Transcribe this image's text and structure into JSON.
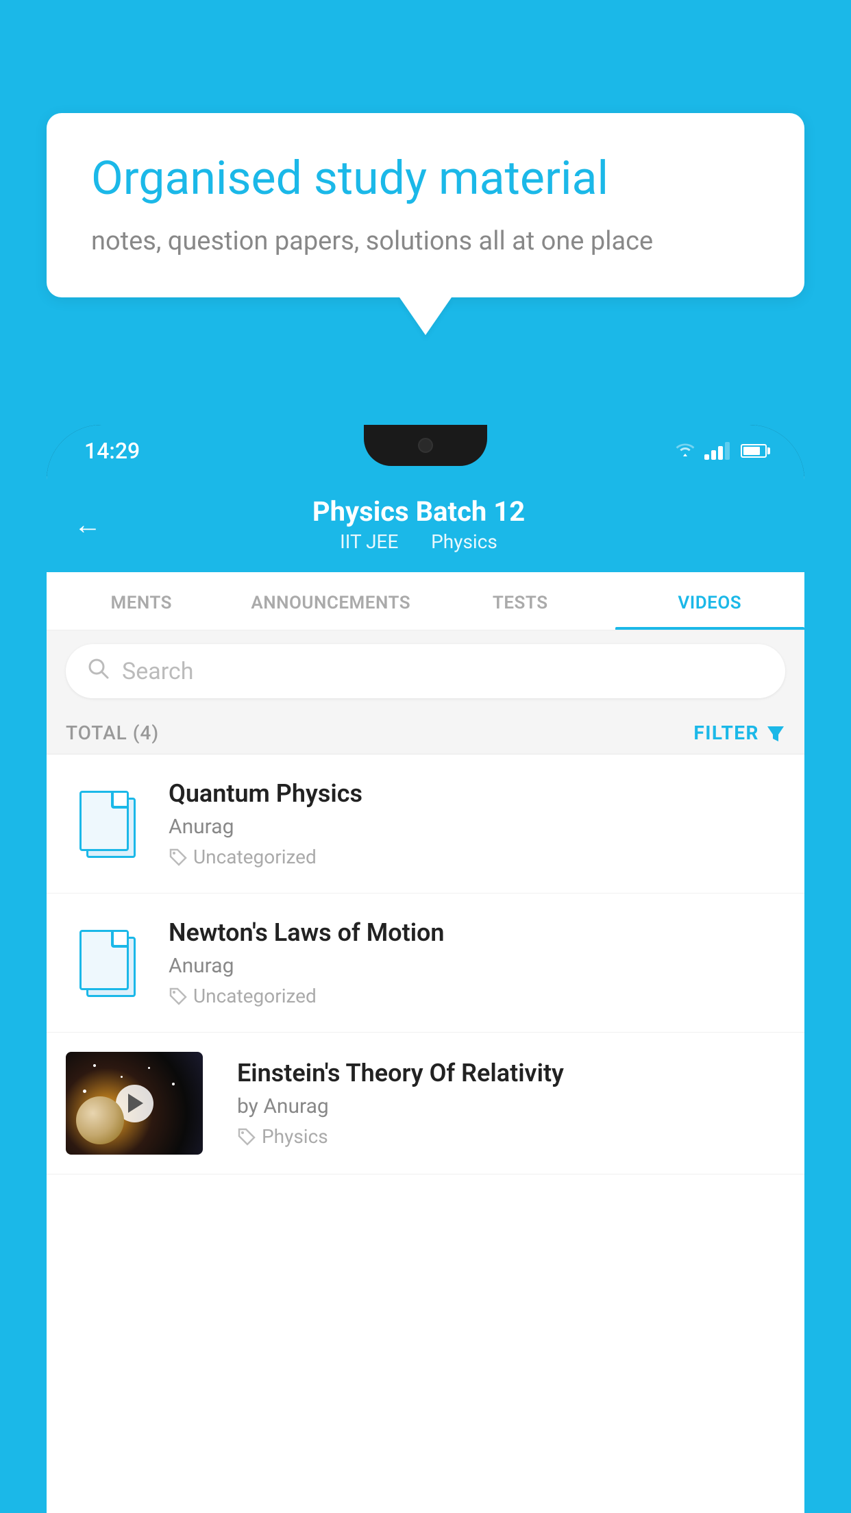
{
  "background_color": "#1BB8E8",
  "hero": {
    "title": "Organised study material",
    "subtitle": "notes, question papers, solutions all at one place"
  },
  "status_bar": {
    "time": "14:29"
  },
  "app_header": {
    "title": "Physics Batch 12",
    "tag1": "IIT JEE",
    "tag2": "Physics"
  },
  "tabs": [
    {
      "label": "MENTS",
      "active": false
    },
    {
      "label": "ANNOUNCEMENTS",
      "active": false
    },
    {
      "label": "TESTS",
      "active": false
    },
    {
      "label": "VIDEOS",
      "active": true
    }
  ],
  "search": {
    "placeholder": "Search"
  },
  "filter_bar": {
    "total_label": "TOTAL (4)",
    "filter_label": "FILTER"
  },
  "videos": [
    {
      "title": "Quantum Physics",
      "author": "Anurag",
      "tag": "Uncategorized",
      "has_thumbnail": false
    },
    {
      "title": "Newton's Laws of Motion",
      "author": "Anurag",
      "tag": "Uncategorized",
      "has_thumbnail": false
    },
    {
      "title": "Einstein's Theory Of Relativity",
      "author": "by Anurag",
      "tag": "Physics",
      "has_thumbnail": true
    }
  ]
}
